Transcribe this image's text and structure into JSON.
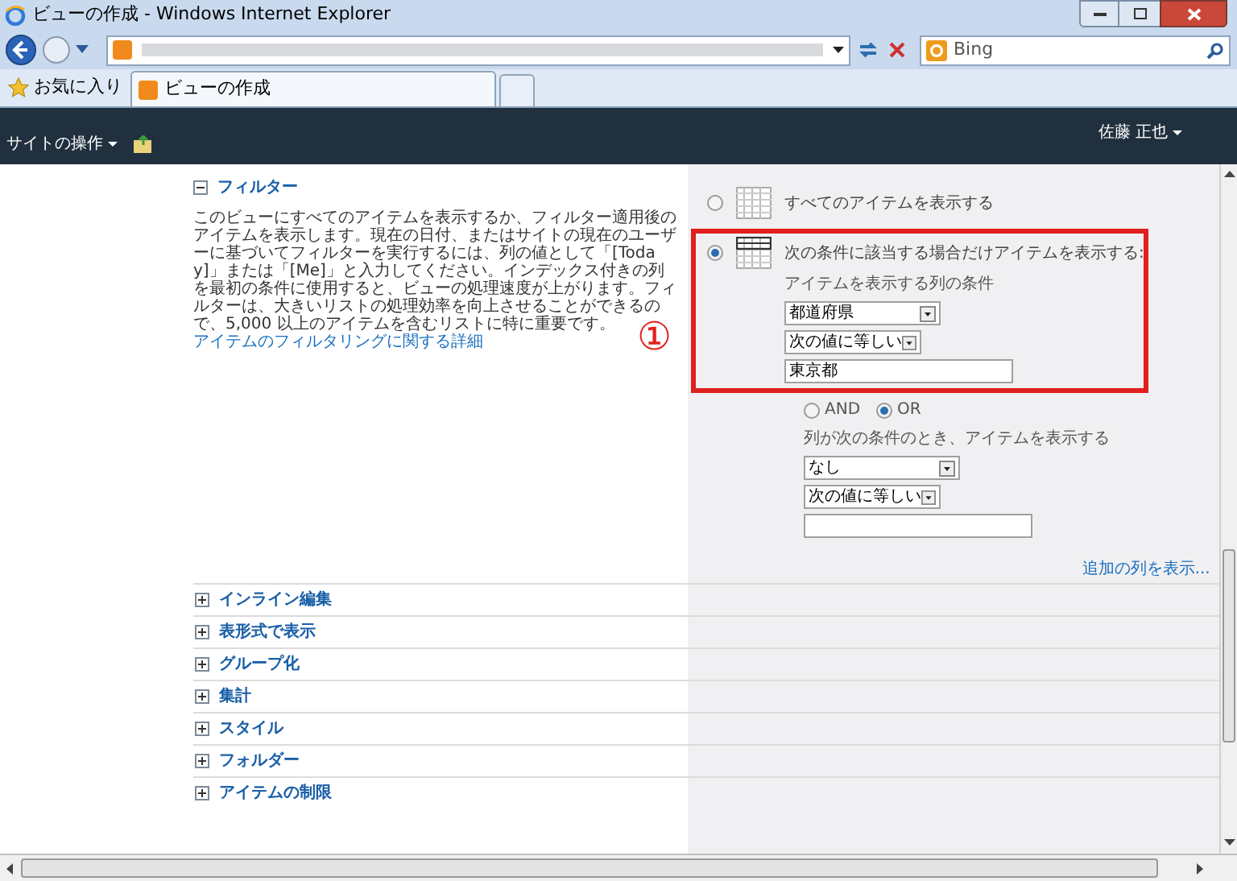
{
  "window": {
    "title": "ビューの作成 - Windows Internet Explorer"
  },
  "search": {
    "placeholder": "Bing"
  },
  "favorites": {
    "label": "お気に入り"
  },
  "tabs": [
    {
      "label": "ビューの作成",
      "selected": true
    }
  ],
  "ribbon": {
    "site_actions": "サイトの操作",
    "user": "佐藤 正也"
  },
  "filter": {
    "title": "フィルター",
    "expanded": true,
    "description": "このビューにすべてのアイテムを表示するか、フィルター適用後のアイテムを表示します。現在の日付、またはサイトの現在のユーザーに基づいてフィルターを実行するには、列の値として「[Today]」または「[Me]」と入力してください。インデックス付きの列を最初の条件に使用すると、ビューの処理速度が上がります。フィルターは、大きいリストの処理効率を向上させることができるので、5,000 以上のアイテムを含むリストに特に重要です。",
    "link": "アイテムのフィルタリングに関する詳細",
    "annotation": "①",
    "options": [
      {
        "label": "すべてのアイテムを表示する",
        "selected": false,
        "highlighted": false
      },
      {
        "label": "次の条件に該当する場合だけアイテムを表示する:",
        "selected": true,
        "highlighted": true
      }
    ],
    "condition1": {
      "label": "アイテムを表示する列の条件",
      "column": "都道府県",
      "operator": "次の値に等しい",
      "value": "東京都"
    },
    "logic": [
      {
        "label": "AND",
        "selected": false
      },
      {
        "label": "OR",
        "selected": true
      }
    ],
    "condition2": {
      "label": "列が次の条件のとき、アイテムを表示する",
      "column": "なし",
      "operator": "次の値に等しい"
    },
    "more_link": "追加の列を表示..."
  },
  "sections": [
    {
      "title": "インライン編集",
      "expanded": false
    },
    {
      "title": "表形式で表示",
      "expanded": false
    },
    {
      "title": "グループ化",
      "expanded": false
    },
    {
      "title": "集計",
      "expanded": false
    },
    {
      "title": "スタイル",
      "expanded": false
    },
    {
      "title": "フォルダー",
      "expanded": false
    },
    {
      "title": "アイテムの制限",
      "expanded": false
    }
  ]
}
